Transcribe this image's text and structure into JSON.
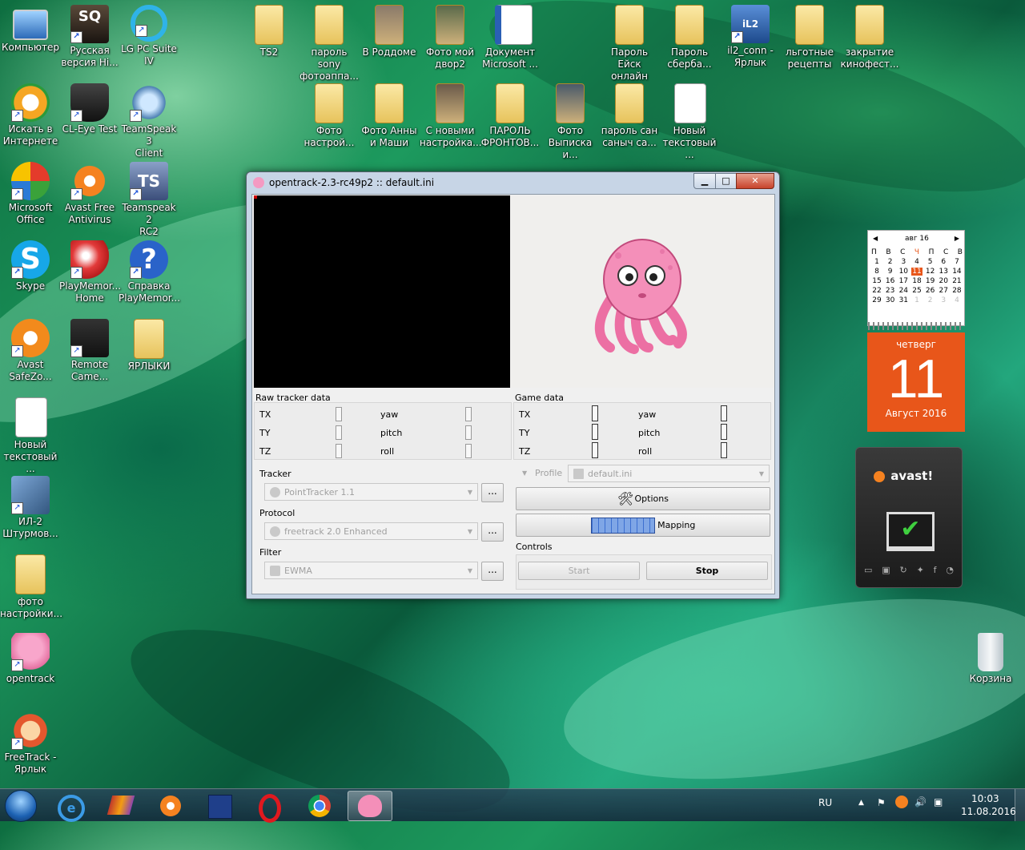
{
  "desktop": {
    "icons": [
      {
        "id": "computer",
        "label": "Компьютер"
      },
      {
        "id": "russian",
        "label": "Русская\nверсия Hi..."
      },
      {
        "id": "lgpc",
        "label": "LG PC Suite\nIV"
      },
      {
        "id": "search",
        "label": "Искать в\nИнтернете"
      },
      {
        "id": "cleye",
        "label": "CL-Eye Test"
      },
      {
        "id": "ts3",
        "label": "TeamSpeak 3\nClient"
      },
      {
        "id": "msoffice",
        "label": "Microsoft\nOffice"
      },
      {
        "id": "avastfree",
        "label": "Avast Free\nAntivirus"
      },
      {
        "id": "ts2",
        "label": "Teamspeak 2\nRC2"
      },
      {
        "id": "skype",
        "label": "Skype"
      },
      {
        "id": "playmem",
        "label": "PlayMemor...\nHome"
      },
      {
        "id": "help",
        "label": "Справка\nPlayMemor..."
      },
      {
        "id": "safezone",
        "label": "Avast\nSafeZo..."
      },
      {
        "id": "remote",
        "label": "Remote\nCame..."
      },
      {
        "id": "shortcuts",
        "label": "ЯРЛЫКИ"
      },
      {
        "id": "newtxt1",
        "label": "Новый\nтекстовый ..."
      },
      {
        "id": "il2",
        "label": "ИЛ-2\nШтурмов..."
      },
      {
        "id": "photosettings",
        "label": "фото\nнастройки..."
      },
      {
        "id": "opentrack",
        "label": "opentrack"
      },
      {
        "id": "freetrack",
        "label": "FreeTrack -\nЯрлык"
      },
      {
        "id": "ts2f",
        "label": "TS2"
      },
      {
        "id": "sonypass",
        "label": "пароль sony\nфотоаппа..."
      },
      {
        "id": "roddom",
        "label": "В Роддоме"
      },
      {
        "id": "mydvor",
        "label": "Фото мой\nдвор2"
      },
      {
        "id": "msdoc",
        "label": "Документ\nMicrosoft ..."
      },
      {
        "id": "eisk",
        "label": "Пароль Ейск\nонлайн"
      },
      {
        "id": "sberbank",
        "label": "Пароль\nсберба..."
      },
      {
        "id": "il2conn",
        "label": "il2_conn -\nЯрлык"
      },
      {
        "id": "recipes",
        "label": "льготные\nрецепты"
      },
      {
        "id": "kinofest",
        "label": "закрытие\nкинофест..."
      },
      {
        "id": "photosetup",
        "label": "Фото\nнастрой..."
      },
      {
        "id": "annamasha",
        "label": "Фото Анны\nи Маши"
      },
      {
        "id": "newsettings",
        "label": "С новыми\nнастройка..."
      },
      {
        "id": "fronts",
        "label": "ПАРОЛЬ\nФРОНТОВ..."
      },
      {
        "id": "vypiska",
        "label": "Фото\nВыписка и..."
      },
      {
        "id": "sanych",
        "label": "пароль сан\nсаныч са..."
      },
      {
        "id": "newtxt2",
        "label": "Новый\nтекстовый ..."
      },
      {
        "id": "recycle",
        "label": "Корзина"
      }
    ]
  },
  "window": {
    "title": "opentrack-2.3-rc49p2 :: default.ini",
    "minimize": "▁",
    "maximize": "□",
    "close": "✕"
  },
  "raw": {
    "label": "Raw tracker data",
    "tx": "TX",
    "ty": "TY",
    "tz": "TZ",
    "yaw": "yaw",
    "pitch": "pitch",
    "roll": "roll"
  },
  "game": {
    "label": "Game data",
    "tx": "TX",
    "ty": "TY",
    "tz": "TZ",
    "yaw": "yaw",
    "pitch": "pitch",
    "roll": "roll"
  },
  "tracker": {
    "label": "Tracker",
    "value": "PointTracker 1.1",
    "more": "..."
  },
  "protocol": {
    "label": "Protocol",
    "value": "freetrack 2.0 Enhanced",
    "more": "..."
  },
  "filter": {
    "label": "Filter",
    "value": "EWMA",
    "more": "..."
  },
  "profile": {
    "label": "Profile",
    "value": "default.ini"
  },
  "buttons": {
    "options": "Options",
    "mapping": "Mapping",
    "start": "Start",
    "stop": "Stop"
  },
  "controls_label": "Controls",
  "calendar": {
    "month": "авг 16",
    "weekdays": [
      "П",
      "В",
      "С",
      "Ч",
      "П",
      "С",
      "В"
    ],
    "weeks": [
      [
        "1",
        "2",
        "3",
        "4",
        "5",
        "6",
        "7"
      ],
      [
        "8",
        "9",
        "10",
        "11",
        "12",
        "13",
        "14"
      ],
      [
        "15",
        "16",
        "17",
        "18",
        "19",
        "20",
        "21"
      ],
      [
        "22",
        "23",
        "24",
        "25",
        "26",
        "27",
        "28"
      ],
      [
        "29",
        "30",
        "31",
        "1",
        "2",
        "3",
        "4"
      ]
    ],
    "dayname": "четверг",
    "day": "11",
    "monthyear": "Август 2016"
  },
  "avast_widget": {
    "brand": "avast!"
  },
  "taskbar": {
    "lang": "RU",
    "time": "10:03",
    "date": "11.08.2016"
  },
  "colors": {
    "accent": "#e8561a",
    "window_frame": "#c7d5e6",
    "octopus": "#f17aa8"
  }
}
